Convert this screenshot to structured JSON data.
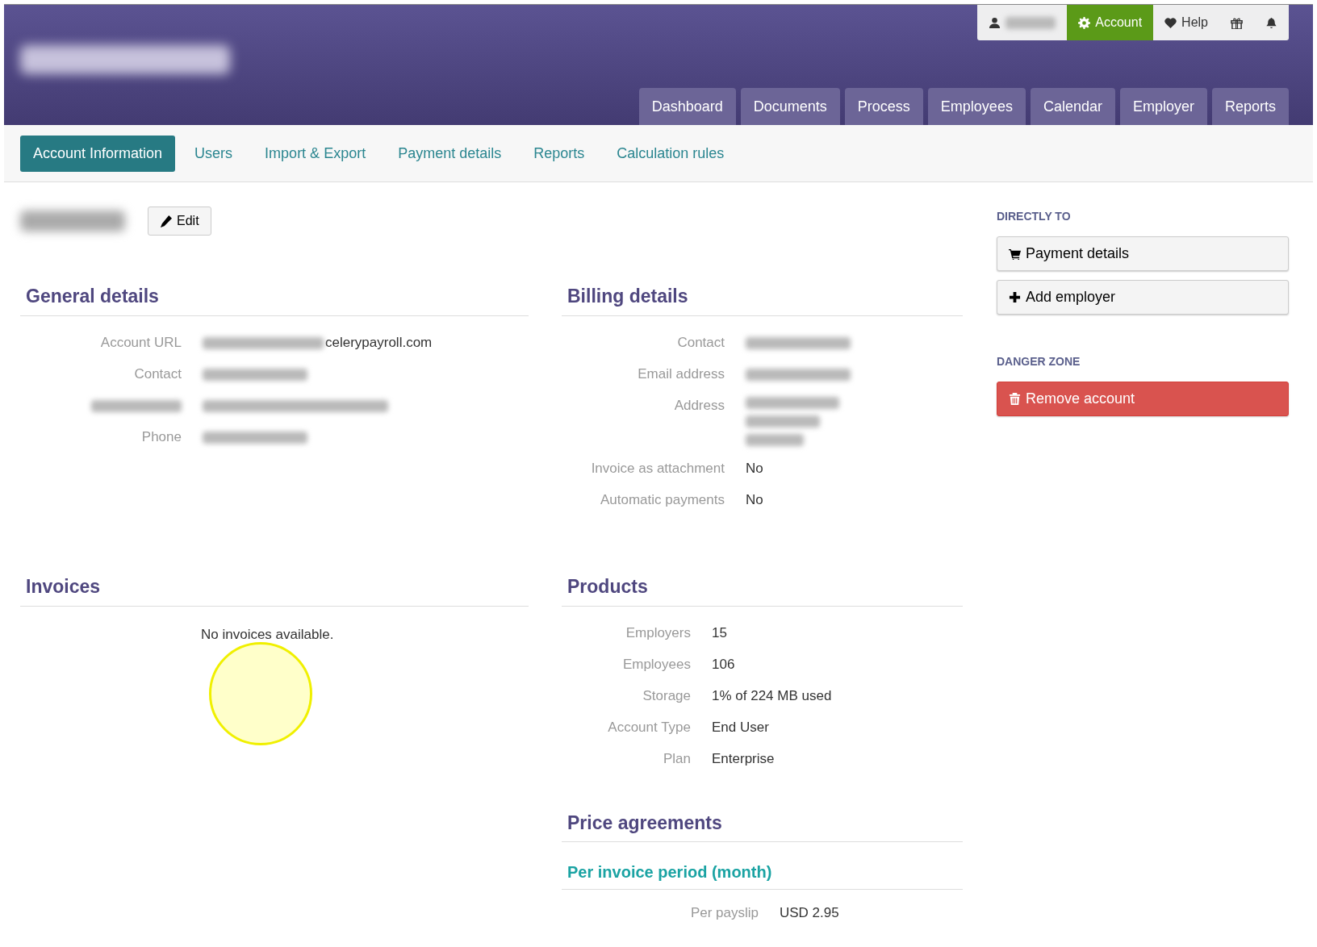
{
  "header": {
    "brand": {
      "blurred": true
    },
    "top_menu": [
      {
        "kind": "user",
        "blurred": true,
        "selected": false
      },
      {
        "kind": "account",
        "label": "Account",
        "selected": true
      },
      {
        "kind": "help",
        "label": "Help",
        "selected": false
      },
      {
        "kind": "gift",
        "selected": false
      },
      {
        "kind": "bell",
        "selected": false
      }
    ],
    "main_tabs": [
      "Dashboard",
      "Documents",
      "Process",
      "Employees",
      "Calendar",
      "Employer",
      "Reports"
    ]
  },
  "sub_tabs": [
    {
      "label": "Account Information",
      "selected": true
    },
    {
      "label": "Users",
      "selected": false
    },
    {
      "label": "Import & Export",
      "selected": false
    },
    {
      "label": "Payment details",
      "selected": false
    },
    {
      "label": "Reports",
      "selected": false
    },
    {
      "label": "Calculation rules",
      "selected": false
    }
  ],
  "account": {
    "name_blurred": true,
    "edit_button": "Edit"
  },
  "general_details": {
    "title": "General details",
    "fields": [
      {
        "label": "Account URL",
        "value": "celerypayroll.com",
        "value_blurred_prefix": true
      },
      {
        "label": "Contact",
        "value_blurred": true
      },
      {
        "label_blurred": true,
        "value_blurred": true
      },
      {
        "label": "Phone",
        "value_blurred": true
      }
    ]
  },
  "billing_details": {
    "title": "Billing details",
    "fields": [
      {
        "label": "Contact",
        "value_blurred": true
      },
      {
        "label": "Email address",
        "value_blurred": true
      },
      {
        "label": "Address",
        "value_blurred": true,
        "kind": "address"
      },
      {
        "label": "Invoice as attachment",
        "value": "No"
      },
      {
        "label": "Automatic payments",
        "value": "No"
      }
    ]
  },
  "invoices": {
    "title": "Invoices",
    "empty_text": "No invoices available."
  },
  "products": {
    "title": "Products",
    "fields": [
      {
        "label": "Employers",
        "value": "15"
      },
      {
        "label": "Employees",
        "value": "106"
      },
      {
        "label": "Storage",
        "value": "1% of 224 MB used"
      },
      {
        "label": "Account Type",
        "value": "End User"
      },
      {
        "label": "Plan",
        "value": "Enterprise"
      }
    ]
  },
  "price_agreements": {
    "title": "Price agreements",
    "subtitle": "Per invoice period (month)",
    "fields": [
      {
        "label": "Per payslip",
        "value": "USD 2.95"
      }
    ]
  },
  "sidebar": {
    "directly_to": {
      "heading": "DIRECTLY TO",
      "buttons": [
        {
          "kind": "cart",
          "label": "Payment details"
        },
        {
          "kind": "plus",
          "label": "Add employer"
        }
      ]
    },
    "danger_zone": {
      "heading": "DANGER ZONE",
      "button": {
        "kind": "trash",
        "label": "Remove account"
      }
    }
  },
  "cursor_highlight": true
}
